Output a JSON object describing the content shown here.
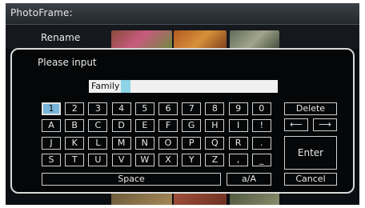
{
  "header": {
    "title": "PhotoFrame:"
  },
  "menu": {
    "item": "Rename"
  },
  "dialog": {
    "prompt": "Please input",
    "input_value": "Family",
    "keyboard": {
      "rows": [
        [
          "1",
          "2",
          "3",
          "4",
          "5",
          "6",
          "7",
          "8",
          "9",
          "0"
        ],
        [
          "A",
          "B",
          "C",
          "D",
          "E",
          "F",
          "G",
          "H",
          "I",
          "!"
        ],
        [
          "J",
          "K",
          "L",
          "M",
          "N",
          "O",
          "P",
          "Q",
          "R",
          "."
        ],
        [
          "S",
          "T",
          "U",
          "V",
          "W",
          "X",
          "Y",
          "Z",
          ",",
          "_"
        ]
      ],
      "selected_key": "1",
      "delete_label": "Delete",
      "left_arrow": "⟵",
      "right_arrow": "⟶",
      "enter_label": "Enter",
      "space_label": "Space",
      "case_label": "a/A",
      "cancel_label": "Cancel"
    }
  },
  "colors": {
    "selected_key": "#78b6d9",
    "cursor": "#8fd3e6",
    "frame": "#d9d9d9"
  }
}
